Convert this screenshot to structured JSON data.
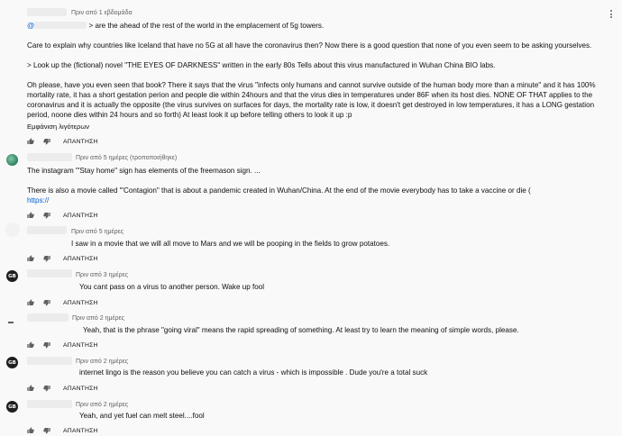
{
  "comments": [
    {
      "meta": "Πριν από 1 εβδομάδα",
      "mention": "@",
      "first_line_rest": " > are the ahead of the rest of the world in the emplacement of 5g towers.",
      "paragraphs": [
        "Care to explain why countries like Iceland that have no 5G at all have the coronavirus then? Now there is a good question that none of you even seem to be asking yourselves.",
        "> Look up the (fictional) novel \"THE EYES OF DARKNESS\" written in the early 80s Tells about this virus manufactured in Wuhan China BIO labs.",
        "Oh please, have you even seen that book? There it says that the virus \"infects only humans and cannot survive outside of the human body more than a minute\" and it has 100% mortality rate, it has a short gestation perion and people die within 24hours and that the virus dies in temperatures under 86F when its host dies. NONE OF THAT applies to the coronavirus and it is actually the opposite (the virus survives on surfaces for days, the mortality rate is low, it doesn't get destroyed in low temperatures, it has a LONG gestation period, noone dies within 24 hours and so forth) At least look it up before telling others to look it up :p"
      ],
      "show_more": "Εμφάνιση λιγότερων",
      "reply_label": "ΑΠΑΝΤΗΣΗ"
    },
    {
      "meta": "Πριν από 5 ημέρες (τροποποιήθηκε)",
      "lines": [
        "The instagram \"'Stay home\" sign has elements of the freemason sign. ...",
        "There is also a movie called \"'Contagion\" that is about a pandemic created in Wuhan/China. At the end of the movie everybody has to take a vaccine or die ("
      ],
      "link": "https://",
      "reply_label": "ΑΠΑΝΤΗΣΗ"
    },
    {
      "meta": "Πριν από 5 ημέρες",
      "text": "I saw in a movie that we will all move to Mars and we will be pooping in the fields to grow potatoes.",
      "reply_label": "ΑΠΑΝΤΗΣΗ"
    },
    {
      "meta": "Πριν από 3 ημέρες",
      "avatar": "GB",
      "text": "You cant pass on a virus to another person. Wake up fool",
      "reply_label": "ΑΠΑΝΤΗΣΗ"
    },
    {
      "meta": "Πριν από 2 ημέρες",
      "text": "Yeah, that is the phrase \"going viral\" means the rapid spreading of something. At least try to learn the meaning of simple words, please.",
      "reply_label": "ΑΠΑΝΤΗΣΗ"
    },
    {
      "meta": "Πριν από 2 ημέρες",
      "avatar": "GB",
      "text": "internet lingo is the reason you believe you can catch a virus - which is impossible . Dude you're a total suck",
      "reply_label": "ΑΠΑΝΤΗΣΗ"
    },
    {
      "meta": "Πριν από 2 ημέρες",
      "avatar": "GB",
      "text": "Yeah, and yet fuel  can melt steel....fool",
      "reply_label": "ΑΠΑΝΤΗΣΗ"
    }
  ],
  "icons": {
    "like": "thumb-up-icon",
    "dislike": "thumb-down-icon",
    "menu": "more-vert-icon"
  },
  "colors": {
    "background": "#f9f9f9",
    "link": "#065fd4",
    "meta": "#606060"
  }
}
